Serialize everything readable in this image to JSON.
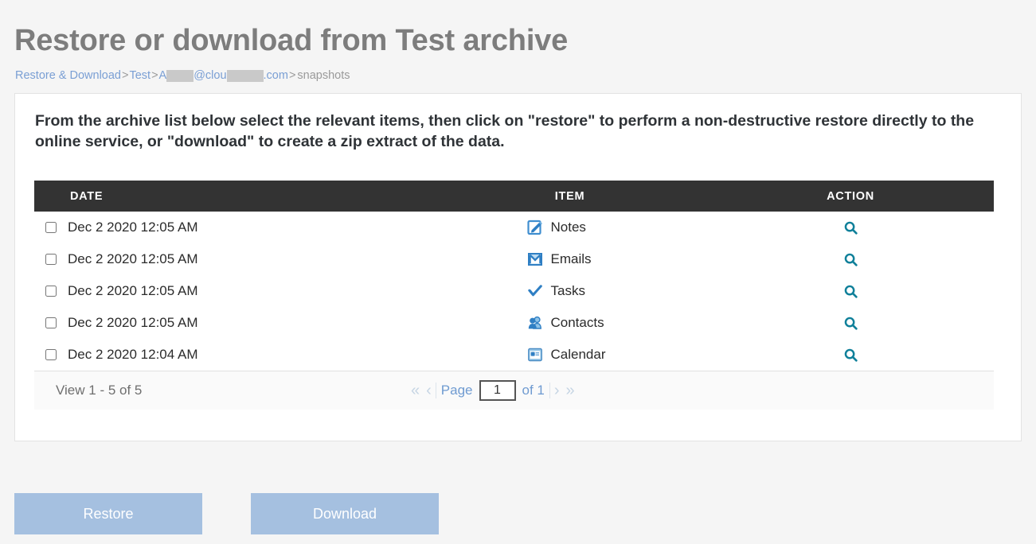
{
  "header": {
    "title": "Restore or download from Test archive",
    "breadcrumb": {
      "root": "Restore & Download",
      "sep": ">",
      "archive": "Test",
      "email_prefix": "A",
      "email_mid": "@clou",
      "email_suffix": ".com",
      "leaf": "snapshots"
    }
  },
  "card": {
    "instructions": "From the archive list below select the relevant items, then click on \"restore\" to perform a non-destructive restore directly to the online service, or \"download\" to create a zip extract of the data."
  },
  "table": {
    "columns": [
      "DATE",
      "ITEM",
      "ACTION"
    ],
    "rows": [
      {
        "date": "Dec 2 2020 12:05 AM",
        "item": "Notes",
        "icon": "notes-icon",
        "action_icon": "search-icon",
        "checked": false
      },
      {
        "date": "Dec 2 2020 12:05 AM",
        "item": "Emails",
        "icon": "emails-icon",
        "action_icon": "search-icon",
        "checked": false
      },
      {
        "date": "Dec 2 2020 12:05 AM",
        "item": "Tasks",
        "icon": "tasks-icon",
        "action_icon": "search-icon",
        "checked": false
      },
      {
        "date": "Dec 2 2020 12:05 AM",
        "item": "Contacts",
        "icon": "contacts-icon",
        "action_icon": "search-icon",
        "checked": false
      },
      {
        "date": "Dec 2 2020 12:04 AM",
        "item": "Calendar",
        "icon": "calendar-icon",
        "action_icon": "search-icon",
        "checked": false
      }
    ],
    "footer": {
      "view_count": "View 1 - 5 of 5",
      "first_label": "«",
      "prev_label": "‹",
      "page_label": "Page",
      "page_value": "1",
      "of_label": "of 1",
      "next_label": "›",
      "last_label": "»"
    }
  },
  "buttons": {
    "restore": "Restore",
    "download": "Download"
  },
  "colors": {
    "page_bg": "#f5f5f5",
    "title": "#7d7d7d",
    "link": "#7a9fd4",
    "table_header_bg": "#333333",
    "action_icon": "#10809a",
    "button_bg": "#a5c0e0"
  }
}
